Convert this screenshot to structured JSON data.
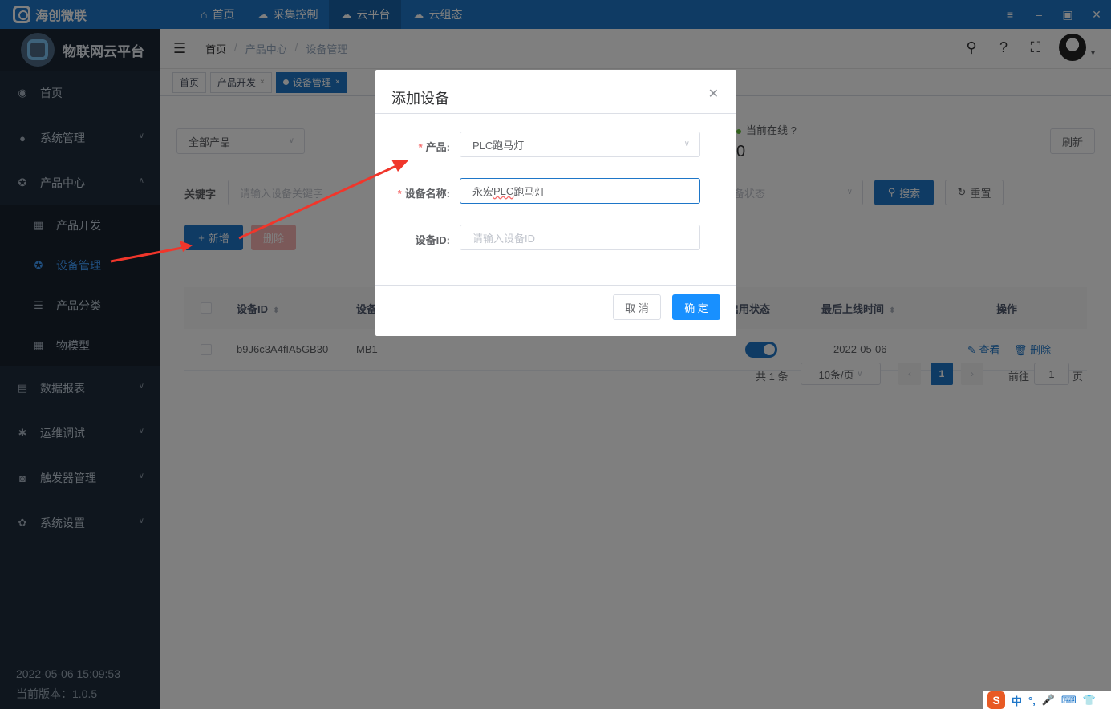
{
  "titlebar": {
    "brand": "海创微联",
    "nav": [
      {
        "label": "首页",
        "icon": "home-icon"
      },
      {
        "label": "采集控制",
        "icon": "cloud-gear-icon"
      },
      {
        "label": "云平台",
        "icon": "cloud-platform-icon"
      },
      {
        "label": "云组态",
        "icon": "cloud-config-icon"
      }
    ]
  },
  "sidebar": {
    "title": "物联网云平台",
    "items": [
      {
        "label": "首页"
      },
      {
        "label": "系统管理"
      },
      {
        "label": "产品中心"
      },
      {
        "label": "数据报表"
      },
      {
        "label": "运维调试"
      },
      {
        "label": "触发器管理"
      },
      {
        "label": "系统设置"
      }
    ],
    "sub_items": [
      {
        "label": "产品开发"
      },
      {
        "label": "设备管理"
      },
      {
        "label": "产品分类"
      },
      {
        "label": "物模型"
      }
    ],
    "datetime": "2022-05-06 15:09:53",
    "version": "当前版本：1.0.5"
  },
  "header": {
    "breadcrumb": [
      "首页",
      "产品中心",
      "设备管理"
    ]
  },
  "tags": [
    {
      "label": "首页"
    },
    {
      "label": "产品开发"
    },
    {
      "label": "设备管理"
    }
  ],
  "filters": {
    "product_select": "全部产品",
    "online_label": "当前在线",
    "online_count": "0",
    "refresh": "刷新",
    "keyword_label": "关键字",
    "keyword_placeholder": "请输入设备关键字",
    "status_placeholder": "备状态",
    "search": "搜索",
    "reset": "重置",
    "add": "新增",
    "delete": "删除"
  },
  "table": {
    "columns": [
      "设备ID",
      "设备",
      "启用状态",
      "最后上线时间",
      "操作"
    ],
    "rows": [
      {
        "id": "b9J6c3A4fIA5GB30",
        "name": "MB1",
        "enabled": true,
        "last_online": "2022-05-06",
        "view": "查看",
        "delete": "删除"
      }
    ]
  },
  "pagination": {
    "total": "共 1 条",
    "page_size": "10条/页",
    "current": "1",
    "goto_prefix": "前往",
    "goto_value": "1",
    "goto_suffix": "页"
  },
  "dialog": {
    "title": "添加设备",
    "product_label": "产品:",
    "product_value": "PLC跑马灯",
    "name_label": "设备名称:",
    "name_value_prefix": "永宏",
    "name_value_underlined": "PLC",
    "name_value_suffix": "跑马灯",
    "id_label": "设备ID:",
    "id_placeholder": "请输入设备ID",
    "cancel": "取 消",
    "confirm": "确 定"
  },
  "ime": {
    "logo": "S",
    "mode": "中"
  },
  "colors": {
    "primary": "#1e76c8",
    "sidebar": "#1f2d3d",
    "danger": "#f56c6c",
    "arrow": "#f0362b"
  }
}
